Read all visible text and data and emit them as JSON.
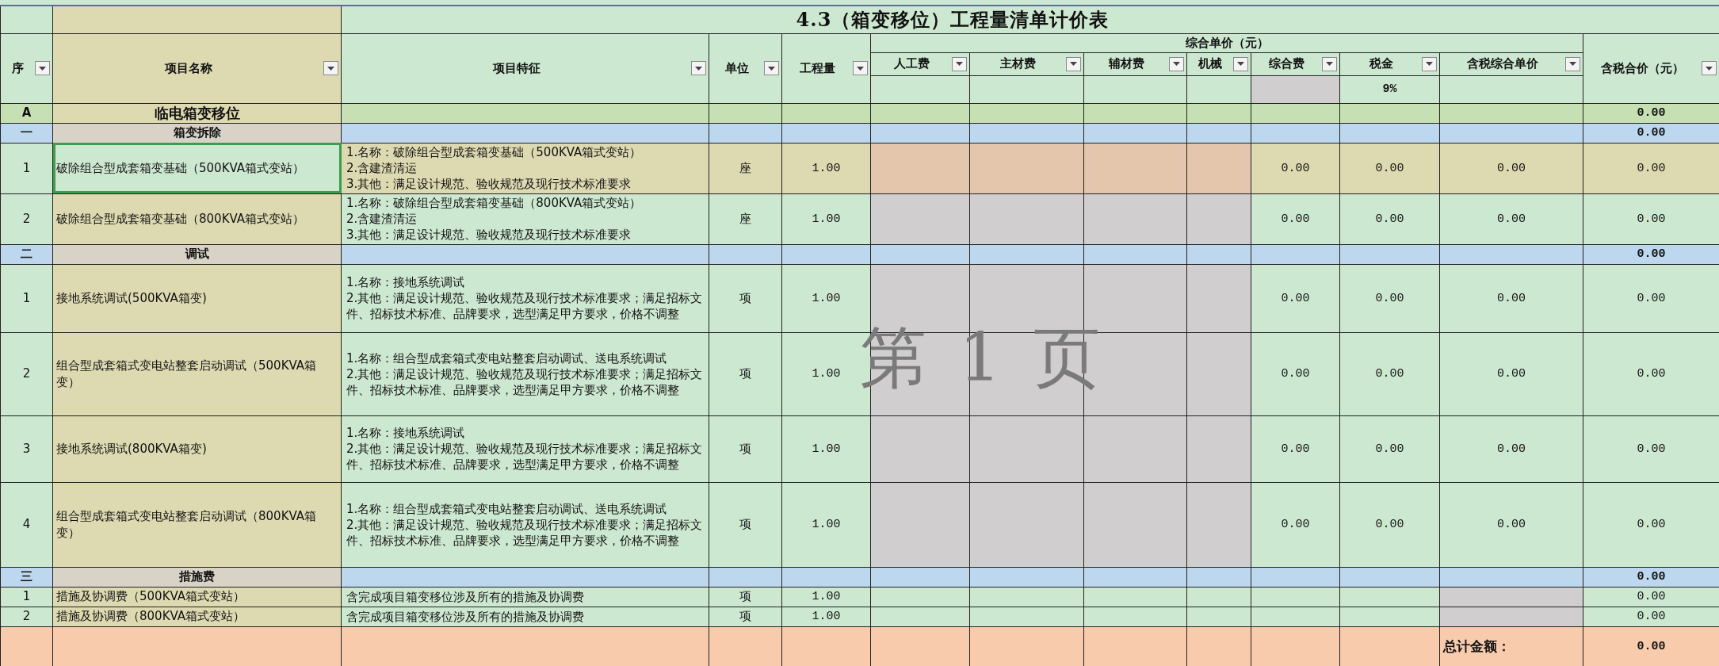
{
  "title": "4.3（箱变移位）工程量清单计价表",
  "columns": [
    {
      "label": "序",
      "filter": true
    },
    {
      "label": "项目名称",
      "filter": true
    },
    {
      "label": "项目特征",
      "filter": true
    },
    {
      "label": "单位",
      "filter": true
    },
    {
      "label": "工程量",
      "filter": true
    }
  ],
  "group_header": "综合单价（元）",
  "price_columns": [
    {
      "label": "人工费",
      "filter": true,
      "kind": "input"
    },
    {
      "label": "主材费",
      "filter": true,
      "kind": "input"
    },
    {
      "label": "辅材费",
      "filter": true,
      "kind": "input"
    },
    {
      "label": "机械",
      "filter": true,
      "kind": "input"
    },
    {
      "label": "综合费",
      "filter": true,
      "kind": "computed"
    },
    {
      "label": "税金",
      "filter": true,
      "kind": "rate",
      "note": "9%"
    },
    {
      "label": "含税综合单价",
      "filter": true,
      "kind": "result"
    }
  ],
  "total_column": {
    "label": "含税合价（元）",
    "filter": true
  },
  "sections": [
    {
      "index": "A",
      "name": "临电箱变移位",
      "total": "0.00",
      "children": [
        {
          "index": "一",
          "name": "箱变拆除",
          "total": "0.00",
          "items": [
            {
              "kind": "priced",
              "index": "1",
              "name": "破除组合型成套箱变基础（500KVA箱式变站）",
              "features": "1.名称：破除组合型成套箱变基础（500KVA箱式变站）\n2.含建渣清运\n3.其他：满足设计规范、验收规范及现行技术标准要求",
              "unit": "座",
              "quantity": "1.00",
              "fee": "0.00",
              "tax": "0.00",
              "unit_price": "0.00",
              "total": "0.00",
              "selected": true
            },
            {
              "kind": "priced",
              "index": "2",
              "name": "破除组合型成套箱变基础（800KVA箱式变站）",
              "features": "1.名称：破除组合型成套箱变基础（800KVA箱式变站）\n2.含建渣清运\n3.其他：满足设计规范、验收规范及现行技术标准要求",
              "unit": "座",
              "quantity": "1.00",
              "fee": "0.00",
              "tax": "0.00",
              "unit_price": "0.00",
              "total": "0.00",
              "selected": false
            }
          ]
        },
        {
          "index": "二",
          "name": "调试",
          "total": "0.00",
          "items": [
            {
              "kind": "priced",
              "index": "1",
              "name": "接地系统调试(500KVA箱变)",
              "features": "1.名称：接地系统调试\n2.其他：满足设计规范、验收规范及现行技术标准要求；满足招标文件、招标技术标准、品牌要求，选型满足甲方要求，价格不调整",
              "unit": "项",
              "quantity": "1.00",
              "fee": "0.00",
              "tax": "0.00",
              "unit_price": "0.00",
              "total": "0.00",
              "selected": false
            },
            {
              "kind": "priced",
              "index": "2",
              "name": "组合型成套箱式变电站整套启动调试（500KVA箱变）",
              "features": "1.名称：组合型成套箱式变电站整套启动调试、送电系统调试\n2.其他：满足设计规范、验收规范及现行技术标准要求；满足招标文件、招标技术标准、品牌要求，选型满足甲方要求，价格不调整",
              "unit": "项",
              "quantity": "1.00",
              "fee": "0.00",
              "tax": "0.00",
              "unit_price": "0.00",
              "total": "0.00",
              "selected": false
            },
            {
              "kind": "priced",
              "index": "3",
              "name": "接地系统调试(800KVA箱变)",
              "features": "1.名称：接地系统调试\n2.其他：满足设计规范、验收规范及现行技术标准要求；满足招标文件、招标技术标准、品牌要求，选型满足甲方要求，价格不调整",
              "unit": "项",
              "quantity": "1.00",
              "fee": "0.00",
              "tax": "0.00",
              "unit_price": "0.00",
              "total": "0.00",
              "selected": false
            },
            {
              "kind": "priced",
              "index": "4",
              "name": "组合型成套箱式变电站整套启动调试（800KVA箱变）",
              "features": "1.名称：组合型成套箱式变电站整套启动调试、送电系统调试\n2.其他：满足设计规范、验收规范及现行技术标准要求；满足招标文件、招标技术标准、品牌要求，选型满足甲方要求，价格不调整",
              "unit": "项",
              "quantity": "1.00",
              "fee": "0.00",
              "tax": "0.00",
              "unit_price": "0.00",
              "total": "0.00",
              "selected": false
            }
          ]
        },
        {
          "index": "三",
          "name": "措施费",
          "total": "0.00",
          "items": [
            {
              "kind": "measure",
              "index": "1",
              "name": "措施及协调费（500KVA箱式变站）",
              "features": "含完成项目箱变移位涉及所有的措施及协调费",
              "unit": "项",
              "quantity": "1.00",
              "total": "0.00",
              "selected": false
            },
            {
              "kind": "measure",
              "index": "2",
              "name": "措施及协调费（800KVA箱式变站）",
              "features": "含完成项目箱变移位涉及所有的措施及协调费",
              "unit": "项",
              "quantity": "1.00",
              "total": "0.00",
              "selected": false
            }
          ]
        }
      ]
    }
  ],
  "grand_total_label": "总计金额：",
  "grand_total": "0.00",
  "page_label": "第 1 页"
}
